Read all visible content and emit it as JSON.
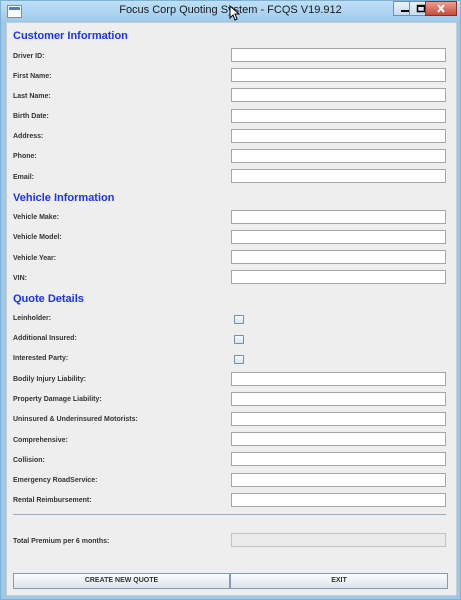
{
  "window": {
    "title": "Focus Corp Quoting System - FCQS V19.912"
  },
  "customer": {
    "heading": "Customer Information",
    "fields": [
      {
        "label": "Driver ID:",
        "value": ""
      },
      {
        "label": "First Name:",
        "value": ""
      },
      {
        "label": "Last Name:",
        "value": ""
      },
      {
        "label": "Birth Date:",
        "value": ""
      },
      {
        "label": "Address:",
        "value": ""
      },
      {
        "label": "Phone:",
        "value": ""
      },
      {
        "label": "Email:",
        "value": ""
      }
    ]
  },
  "vehicle": {
    "heading": "Vehicle Information",
    "fields": [
      {
        "label": "Vehicle Make:",
        "value": ""
      },
      {
        "label": "Vehicle Model:",
        "value": ""
      },
      {
        "label": "Vehicle Year:",
        "value": ""
      },
      {
        "label": "VIN:",
        "value": ""
      }
    ]
  },
  "quote": {
    "heading": "Quote Details",
    "checkboxes": [
      {
        "label": "Leinholder:",
        "checked": false
      },
      {
        "label": "Additional Insured:",
        "checked": false
      },
      {
        "label": "Interested Party:",
        "checked": false
      }
    ],
    "fields": [
      {
        "label": "Bodily Injury Liability:",
        "value": ""
      },
      {
        "label": "Property Damage Liability:",
        "value": ""
      },
      {
        "label": "Uninsured & Underinsured Motorists:",
        "value": ""
      },
      {
        "label": "Comprehensive:",
        "value": ""
      },
      {
        "label": "Collision:",
        "value": ""
      },
      {
        "label": "Emergency RoadService:",
        "value": ""
      },
      {
        "label": "Rental Reimbursement:",
        "value": ""
      }
    ]
  },
  "total": {
    "label": "Total Premium per 6 months:",
    "value": ""
  },
  "buttons": {
    "create": "CREATE NEW QUOTE",
    "exit": "EXIT"
  }
}
